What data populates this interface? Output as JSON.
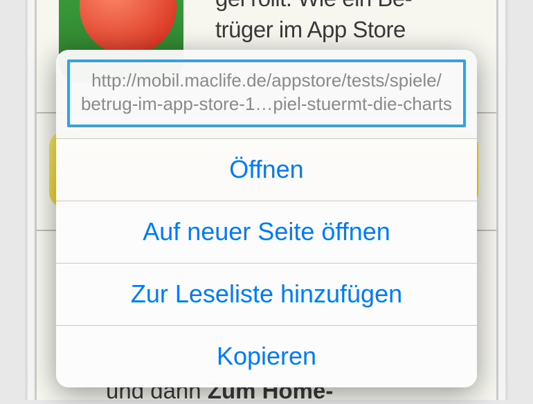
{
  "background": {
    "article_text_top": "gel rollt. Wie ein Be-\ntrüger im App Store",
    "article_text_bottom_plain": "und dann ",
    "article_text_bottom_bold": "Zum Home-"
  },
  "sheet": {
    "url_line1": "http://mobil.maclife.de/appstore/tests/spiele/",
    "url_line2": "betrug-im-app-store-1…piel-stuermt-die-charts",
    "actions": {
      "open": "Öffnen",
      "open_new_page": "Auf neuer Seite öffnen",
      "add_to_reading_list": "Zur Leseliste hinzufügen",
      "copy": "Kopieren"
    }
  }
}
